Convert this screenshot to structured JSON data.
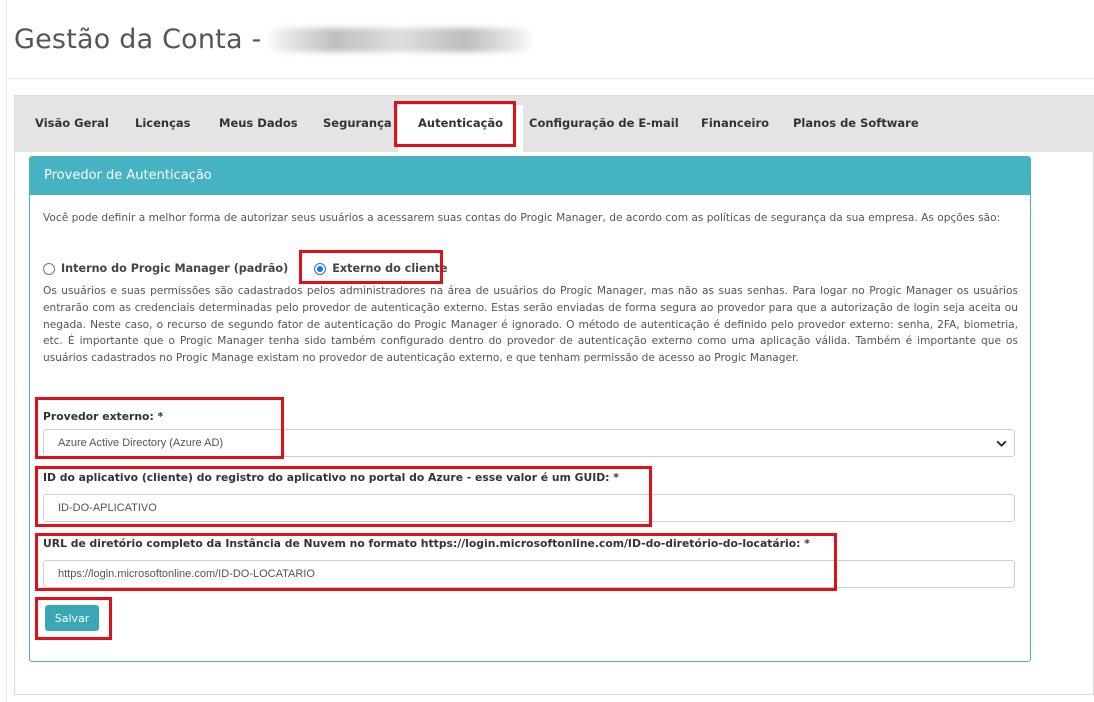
{
  "page": {
    "title": "Gestão da Conta -"
  },
  "tabs": [
    {
      "label": "Visão Geral"
    },
    {
      "label": "Licenças"
    },
    {
      "label": "Meus Dados"
    },
    {
      "label": "Segurança"
    },
    {
      "label": "Autenticação",
      "active": true
    },
    {
      "label": "Configuração de E-mail"
    },
    {
      "label": "Financeiro"
    },
    {
      "label": "Planos de Software"
    }
  ],
  "panel": {
    "header": "Provedor de Autenticação",
    "intro": "Você pode definir a melhor forma de autorizar seus usuários a acessarem suas contas do Progic Manager, de acordo com as políticas de segurança da sua empresa. As opções são:",
    "options": {
      "internal": "Interno do Progic Manager (padrão)",
      "external": "Externo do cliente",
      "selected": "external"
    },
    "description": "Os usuários e suas permissões são cadastrados pelos administradores na área de usuários do Progic Manager, mas não as suas senhas. Para logar no Progic Manager os usuários entrarão com as credenciais determinadas pelo provedor de autenticação externo. Estas serão enviadas de forma segura ao provedor para que a autorização de login seja aceita ou negada. Neste caso, o recurso de segundo fator de autenticação do Progic Manager é ignorado. O método de autenticação é definido pelo provedor externo: senha, 2FA, biometria, etc. É importante que o Progic Manager tenha sido também configurado dentro do provedor de autenticação externo como uma aplicação válida. Também é importante que os usuários cadastrados no Progic Manage existam no provedor de autenticação externo, e que tenham permissão de acesso ao Progic Manager.",
    "provider": {
      "label": "Provedor externo: *",
      "value": "Azure Active Directory (Azure AD)"
    },
    "app_id": {
      "label": "ID do aplicativo (cliente) do registro do aplicativo no portal do Azure - esse valor é um GUID: *",
      "value": "ID-DO-APLICATIVO"
    },
    "directory_url": {
      "label": "URL de diretório completo da Instância de Nuvem no formato https://login.microsoftonline.com/ID-do-diretório-do-locatário: *",
      "value": "https://login.microsoftonline.com/ID-DO-LOCATARIO"
    },
    "save_label": "Salvar"
  },
  "colors": {
    "accent": "#45b3c2",
    "button": "#3aa8b4",
    "highlight": "#e0101a",
    "radio_selected": "#1a73e8"
  }
}
